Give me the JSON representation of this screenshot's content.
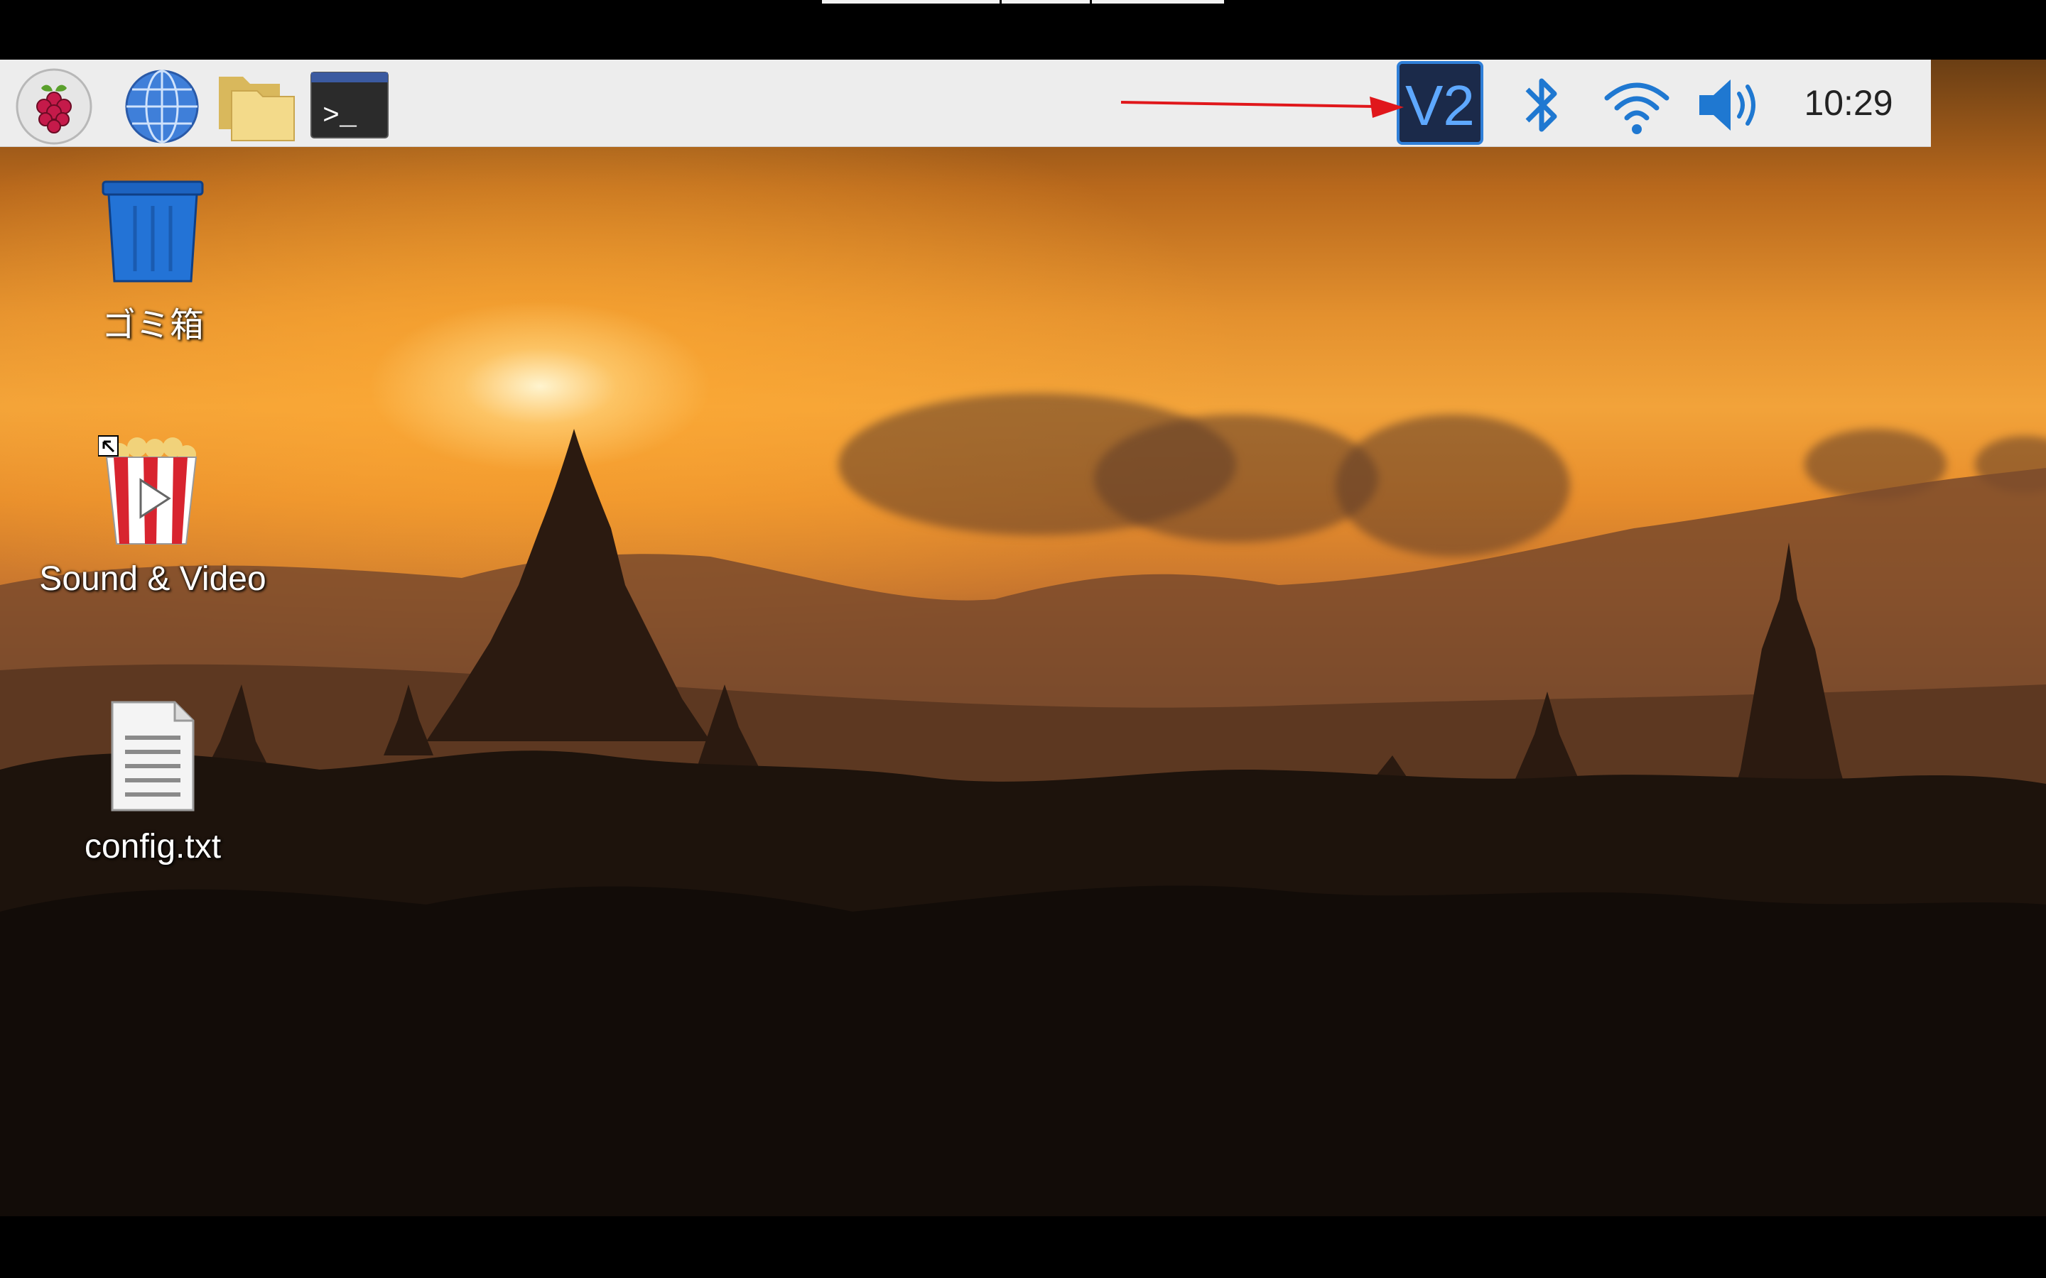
{
  "taskbar": {
    "launchers": [
      {
        "name": "raspberry-pi-menu",
        "icon": "raspberry-icon"
      },
      {
        "name": "web-browser",
        "icon": "globe-icon"
      },
      {
        "name": "file-manager",
        "icon": "folder-icon"
      },
      {
        "name": "terminal",
        "icon": "terminal-icon"
      }
    ],
    "terminal_prompt": ">_",
    "tray": {
      "vnc": {
        "label": "V2",
        "icon": "vnc-icon",
        "bg": "#1b2a4a",
        "accent": "#2f7fd8"
      },
      "bluetooth": {
        "icon": "bluetooth-icon",
        "color": "#1f78d1"
      },
      "wifi": {
        "icon": "wifi-icon",
        "color": "#1f78d1"
      },
      "volume": {
        "icon": "volume-icon",
        "color": "#1f78d1"
      },
      "clock": "10:29"
    }
  },
  "annotation": {
    "arrow_color": "#e0171b",
    "points_to": "vnc-icon"
  },
  "desktop_icons": [
    {
      "label": "ゴミ箱",
      "icon": "trash-icon"
    },
    {
      "label": "Sound & Video",
      "icon": "popcorn-video-icon"
    },
    {
      "label": "config.txt",
      "icon": "text-file-icon"
    }
  ],
  "wallpaper": "sunset-temples-landscape"
}
